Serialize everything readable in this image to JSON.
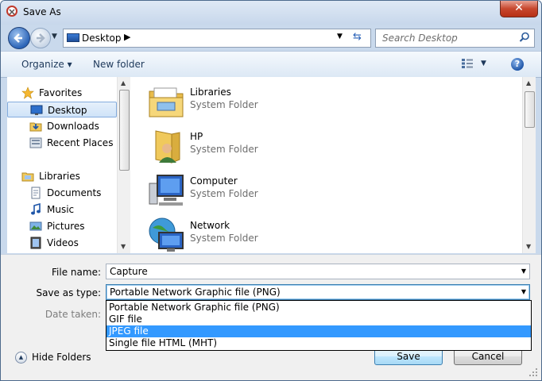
{
  "window": {
    "title": "Save As",
    "close_label": "✕"
  },
  "nav": {
    "address_location": "Desktop",
    "search_placeholder": "Search Desktop"
  },
  "toolbar": {
    "organize_label": "Organize ▾",
    "new_folder_label": "New folder",
    "help_label": "?"
  },
  "sidebar": {
    "favorites_label": "Favorites",
    "favorites": [
      {
        "label": "Desktop",
        "icon": "desktop-icon"
      },
      {
        "label": "Downloads",
        "icon": "downloads-icon"
      },
      {
        "label": "Recent Places",
        "icon": "recent-places-icon"
      }
    ],
    "libraries_label": "Libraries",
    "libraries": [
      {
        "label": "Documents",
        "icon": "documents-icon"
      },
      {
        "label": "Music",
        "icon": "music-icon"
      },
      {
        "label": "Pictures",
        "icon": "pictures-icon"
      },
      {
        "label": "Videos",
        "icon": "videos-icon"
      }
    ]
  },
  "files": [
    {
      "name": "Libraries",
      "type": "System Folder",
      "icon": "libraries-folder-icon"
    },
    {
      "name": "HP",
      "type": "System Folder",
      "icon": "user-folder-icon"
    },
    {
      "name": "Computer",
      "type": "System Folder",
      "icon": "computer-icon"
    },
    {
      "name": "Network",
      "type": "System Folder",
      "icon": "network-icon"
    }
  ],
  "form": {
    "file_name_label": "File name:",
    "file_name_value": "Capture",
    "save_type_label": "Save as type:",
    "save_type_value": "Portable Network Graphic file (PNG)",
    "date_taken_label": "Date taken:",
    "type_options": [
      "Portable Network Graphic file (PNG)",
      "GIF file",
      "JPEG file",
      "Single file HTML (MHT)"
    ],
    "highlighted_option_index": 2
  },
  "footer": {
    "hide_folders_label": "Hide Folders",
    "save_label": "Save",
    "cancel_label": "Cancel"
  },
  "colors": {
    "selection": "#3399ff",
    "frame": "#c9d9ec",
    "close": "#c7472e"
  }
}
